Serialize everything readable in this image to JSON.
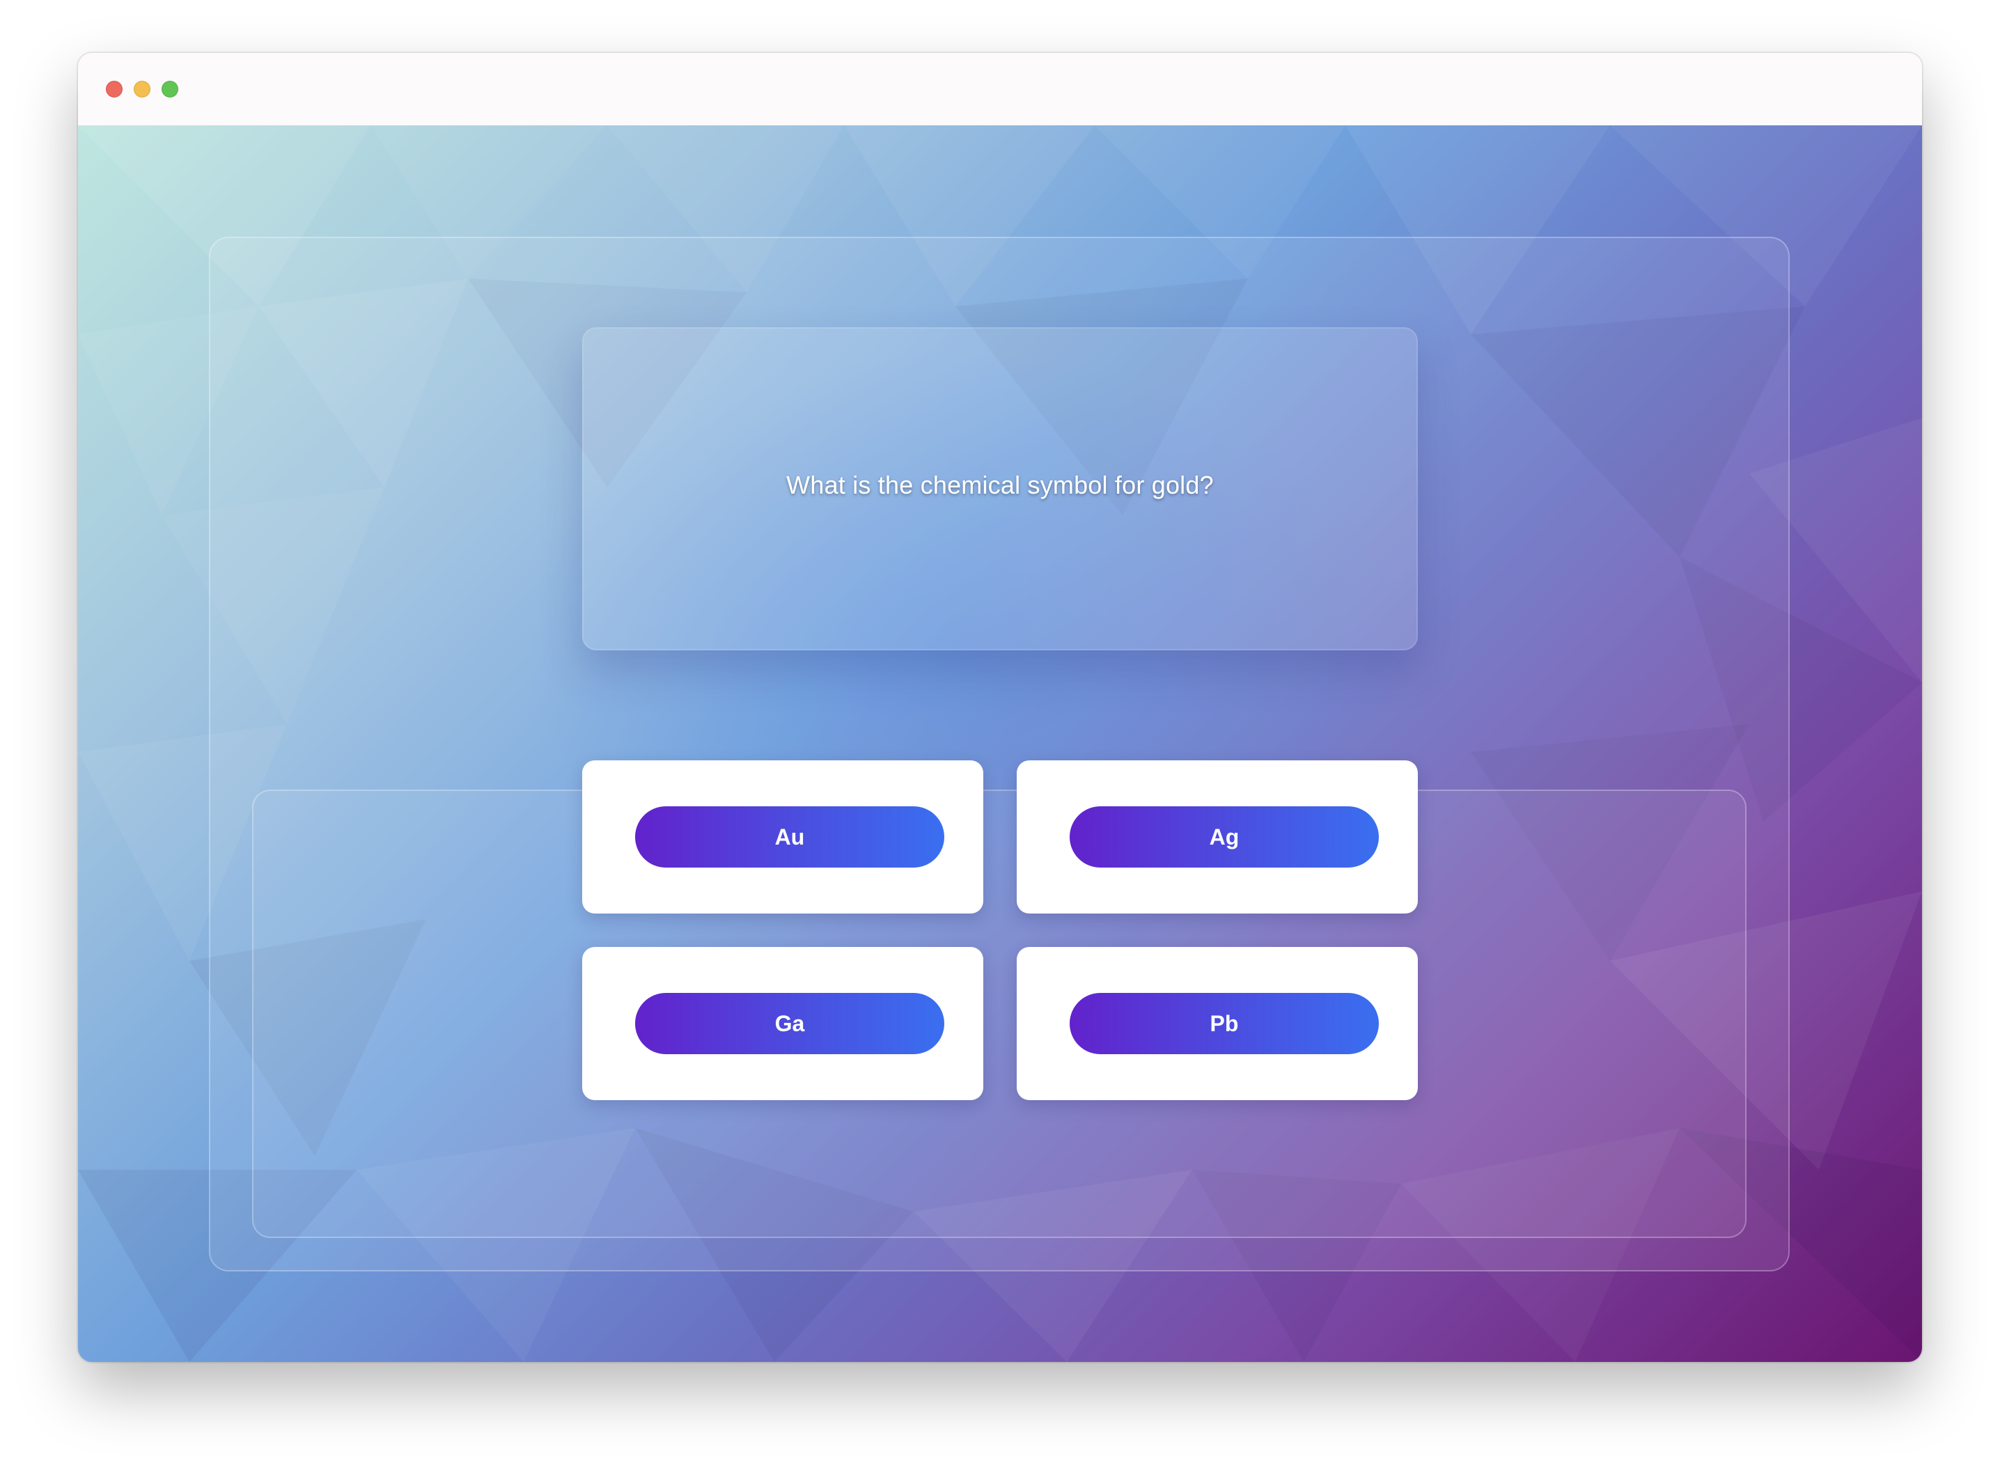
{
  "window": {
    "controls": [
      "close",
      "minimize",
      "zoom"
    ]
  },
  "quiz": {
    "question": "What is the chemical symbol for gold?",
    "answers": [
      {
        "label": "Au"
      },
      {
        "label": "Ag"
      },
      {
        "label": "Ga"
      },
      {
        "label": "Pb"
      }
    ]
  },
  "colors": {
    "button_gradient_start": "#6222cc",
    "button_gradient_end": "#3a6ff0",
    "background_top_left": "#bfe6df",
    "background_bottom_right": "#6a1570"
  }
}
